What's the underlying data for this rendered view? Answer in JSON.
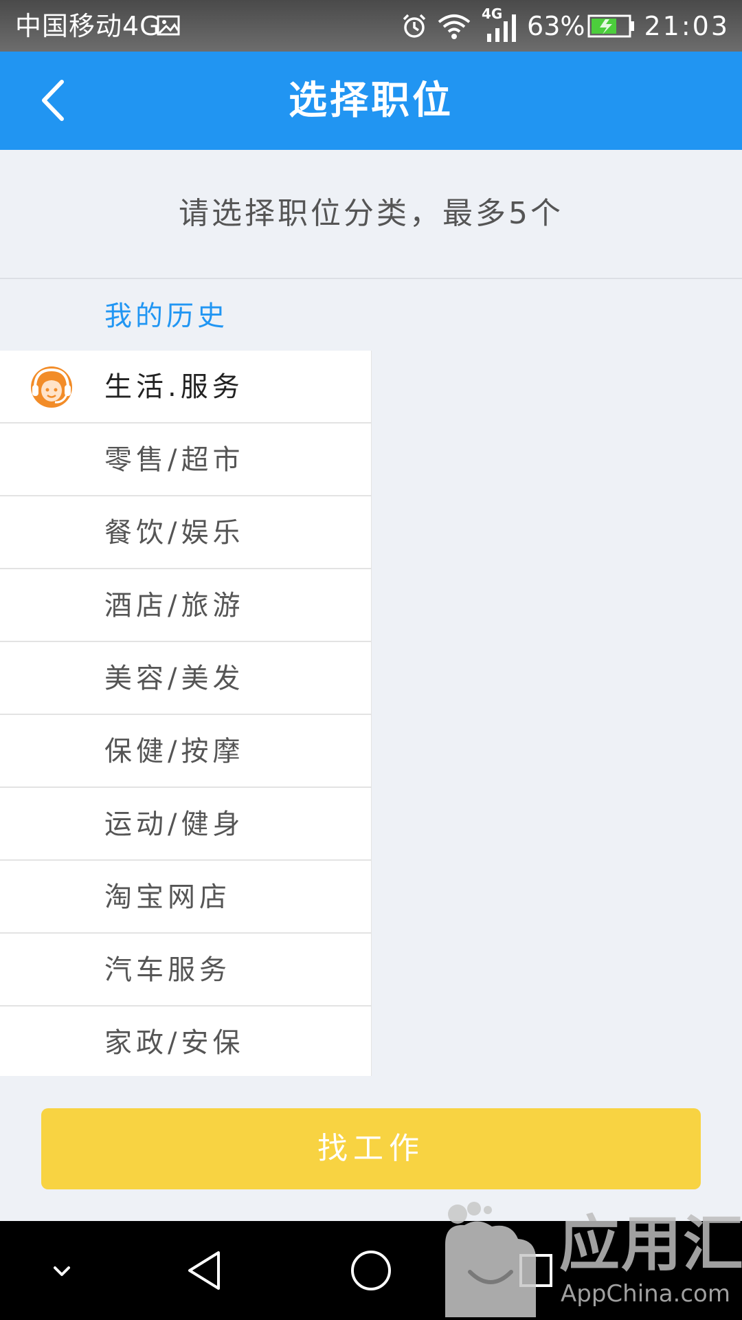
{
  "status_bar": {
    "carrier": "中国移动4G",
    "network_badge": "4G",
    "battery_percent": "63%",
    "time": "21:03",
    "icons": [
      "image-icon",
      "alarm-icon",
      "wifi-icon",
      "signal-icon",
      "battery-charging-icon"
    ]
  },
  "header": {
    "title": "选择职位",
    "back_icon": "back-chevron-icon"
  },
  "instruction": "请选择职位分类，最多5个",
  "history_label": "我的历史",
  "categories": [
    {
      "label": "生活.服务",
      "icon": "customer-service-avatar-icon",
      "active": true
    },
    {
      "label": "零售/超市"
    },
    {
      "label": "餐饮/娱乐"
    },
    {
      "label": "酒店/旅游"
    },
    {
      "label": "美容/美发"
    },
    {
      "label": "保健/按摩"
    },
    {
      "label": "运动/健身"
    },
    {
      "label": "淘宝网店"
    },
    {
      "label": "汽车服务"
    },
    {
      "label": "家政/安保"
    }
  ],
  "find_job_button": "找工作",
  "nav_bar": {
    "icons": [
      "hide-keyboard-icon",
      "back-triangle-icon",
      "home-circle-icon",
      "recents-square-icon"
    ]
  },
  "watermark": {
    "text": "应用汇",
    "sub": "AppChina.com"
  },
  "colors": {
    "header_blue": "#2195f2",
    "accent_blue_text": "#2196f3",
    "button_yellow": "#f8d342",
    "page_background": "#eef1f6",
    "icon_orange": "#f28c28"
  }
}
